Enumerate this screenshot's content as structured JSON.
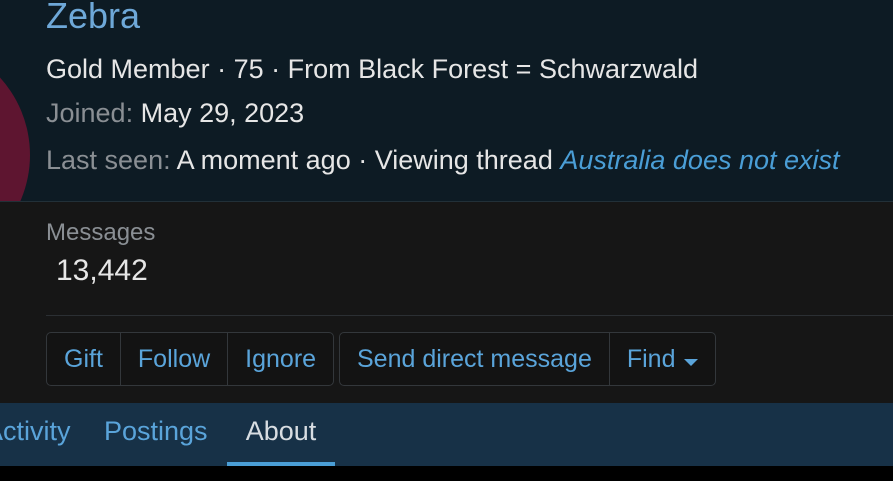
{
  "profile": {
    "username": "Zebra",
    "title": "Gold Member",
    "separator": " · ",
    "age": "75",
    "location_prefix": "From",
    "location": "Black Forest = Schwarzwald",
    "joined_label": "Joined:",
    "joined_value": "May 29, 2023",
    "last_seen_label": "Last seen:",
    "last_seen_value": "A moment ago",
    "activity_text": "Viewing thread",
    "thread_title": "Australia does not exist",
    "avatar_color": "#5e1530",
    "link_color": "#4a9ed6"
  },
  "stats": {
    "messages_label": "Messages",
    "messages_value": "13,442"
  },
  "actions": {
    "gift": "Gift",
    "follow": "Follow",
    "ignore": "Ignore",
    "send_message": "Send direct message",
    "find": "Find"
  },
  "tabs": {
    "activity": "Activity",
    "postings": "Postings",
    "about": "About",
    "active": "About"
  }
}
